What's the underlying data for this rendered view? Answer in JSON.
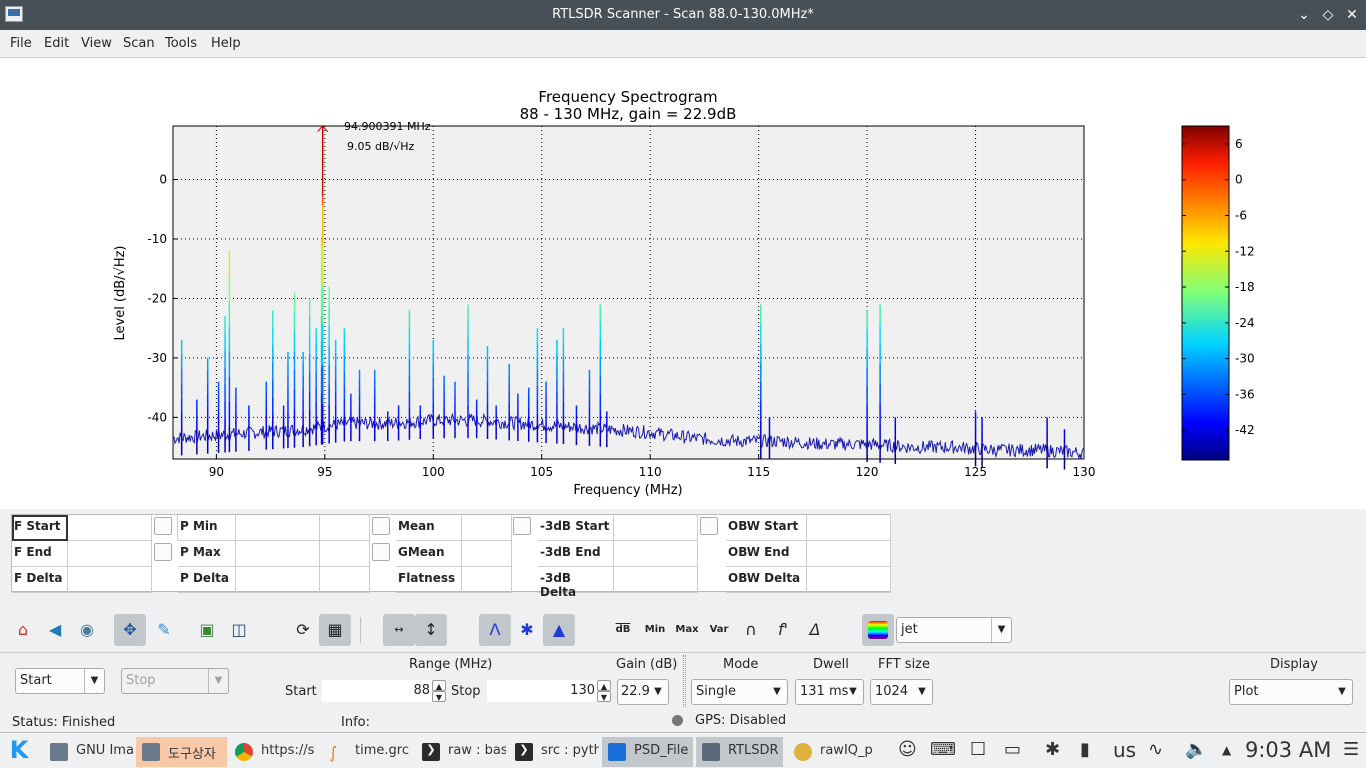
{
  "window": {
    "title": "RTLSDR Scanner - Scan 88.0-130.0MHz*"
  },
  "menu": [
    "File",
    "Edit",
    "View",
    "Scan",
    "Tools",
    "Help"
  ],
  "chart_data": {
    "type": "line",
    "title": "Frequency Spectrogram",
    "subtitle": "88 - 130 MHz, gain = 22.9dB",
    "xlabel": "Frequency (MHz)",
    "ylabel": "Level (dB/√Hz)",
    "xlim": [
      88,
      130
    ],
    "ylim": [
      -47,
      9
    ],
    "xticks": [
      90,
      95,
      100,
      105,
      110,
      115,
      120,
      125,
      130
    ],
    "yticks": [
      0,
      -10,
      -20,
      -30,
      -40
    ],
    "grid": true,
    "colormap": "jet",
    "colorbar": {
      "ticks": [
        6,
        0,
        -6,
        -12,
        -18,
        -24,
        -30,
        -36,
        -42
      ],
      "range": [
        -47,
        9
      ]
    },
    "noise_floor": [
      [
        88,
        -43.5
      ],
      [
        90,
        -43
      ],
      [
        92,
        -42.5
      ],
      [
        94,
        -42
      ],
      [
        96,
        -41
      ],
      [
        98,
        -41
      ],
      [
        100,
        -40.5
      ],
      [
        102,
        -40.5
      ],
      [
        104,
        -41
      ],
      [
        106,
        -41.5
      ],
      [
        108,
        -42
      ],
      [
        110,
        -42.5
      ],
      [
        112,
        -43.5
      ],
      [
        114,
        -44
      ],
      [
        116,
        -44
      ],
      [
        118,
        -44.5
      ],
      [
        120,
        -44.5
      ],
      [
        122,
        -45
      ],
      [
        124,
        -45
      ],
      [
        126,
        -45.5
      ],
      [
        128,
        -45.5
      ],
      [
        130,
        -46
      ]
    ],
    "peaks": [
      {
        "x": 88.4,
        "y": -27
      },
      {
        "x": 89.1,
        "y": -37
      },
      {
        "x": 89.6,
        "y": -30
      },
      {
        "x": 90.1,
        "y": -34
      },
      {
        "x": 90.4,
        "y": -23
      },
      {
        "x": 90.6,
        "y": -12
      },
      {
        "x": 90.9,
        "y": -35
      },
      {
        "x": 91.5,
        "y": -38
      },
      {
        "x": 92.3,
        "y": -34
      },
      {
        "x": 92.6,
        "y": -22
      },
      {
        "x": 93.1,
        "y": -38
      },
      {
        "x": 93.3,
        "y": -29
      },
      {
        "x": 93.6,
        "y": -19
      },
      {
        "x": 94.0,
        "y": -29
      },
      {
        "x": 94.3,
        "y": -20
      },
      {
        "x": 94.6,
        "y": -25
      },
      {
        "x": 94.85,
        "y": -10
      },
      {
        "x": 94.9,
        "y": 9.05
      },
      {
        "x": 95.2,
        "y": -18
      },
      {
        "x": 95.5,
        "y": -27
      },
      {
        "x": 95.9,
        "y": -25
      },
      {
        "x": 96.2,
        "y": -36
      },
      {
        "x": 96.6,
        "y": -32
      },
      {
        "x": 97.3,
        "y": -32
      },
      {
        "x": 97.9,
        "y": -39
      },
      {
        "x": 98.4,
        "y": -38
      },
      {
        "x": 98.9,
        "y": -22
      },
      {
        "x": 99.4,
        "y": -38
      },
      {
        "x": 100.0,
        "y": -27
      },
      {
        "x": 100.5,
        "y": -33
      },
      {
        "x": 101.0,
        "y": -34
      },
      {
        "x": 101.6,
        "y": -21
      },
      {
        "x": 102.0,
        "y": -37
      },
      {
        "x": 102.5,
        "y": -28
      },
      {
        "x": 102.9,
        "y": -38
      },
      {
        "x": 103.5,
        "y": -31
      },
      {
        "x": 103.9,
        "y": -36
      },
      {
        "x": 104.4,
        "y": -35
      },
      {
        "x": 104.8,
        "y": -25
      },
      {
        "x": 105.2,
        "y": -34
      },
      {
        "x": 105.7,
        "y": -27
      },
      {
        "x": 106.0,
        "y": -25
      },
      {
        "x": 106.6,
        "y": -38
      },
      {
        "x": 107.2,
        "y": -32
      },
      {
        "x": 107.7,
        "y": -21
      },
      {
        "x": 108.0,
        "y": -39
      },
      {
        "x": 115.1,
        "y": -21
      },
      {
        "x": 115.5,
        "y": -40
      },
      {
        "x": 120.0,
        "y": -22
      },
      {
        "x": 120.6,
        "y": -21
      },
      {
        "x": 121.3,
        "y": -40
      },
      {
        "x": 125.0,
        "y": -39
      },
      {
        "x": 125.3,
        "y": -40
      },
      {
        "x": 128.3,
        "y": -40
      },
      {
        "x": 129.1,
        "y": -42
      }
    ],
    "annotation": {
      "text": "94.900391 MHz",
      "text2": "9.05 dB/√Hz"
    }
  },
  "measurements": {
    "rows": [
      [
        "F Start",
        "P Min",
        "Mean",
        "-3dB Start",
        "OBW Start"
      ],
      [
        "F End",
        "P Max",
        "GMean",
        "-3dB End",
        "OBW End"
      ],
      [
        "F Delta",
        "P Delta",
        "Flatness",
        "-3dB Delta",
        "OBW Delta"
      ]
    ]
  },
  "toolbar": {
    "icons": [
      "home-icon",
      "back-icon",
      "forward-icon",
      "pan-icon",
      "configure-icon",
      "subplots-icon",
      "save-icon",
      "refresh-icon",
      "grid-icon",
      "fit-horizontal-icon",
      "fit-vertical-icon",
      "peak-icon",
      "peaks-icon",
      "fill-icon"
    ],
    "text_buttons": [
      "dB",
      "Min",
      "Max",
      "Var",
      "∩",
      "f'",
      "Δ"
    ],
    "colormap": "jet"
  },
  "controls": {
    "start_combo": "Start",
    "stop_combo": "Stop",
    "range_label": "Range (MHz)",
    "start_label": "Start",
    "start_value": "88",
    "stop_label": "Stop",
    "stop_value": "130",
    "gain_label": "Gain (dB)",
    "gain_value": "22.9",
    "mode_label": "Mode",
    "mode_value": "Single",
    "dwell_label": "Dwell",
    "dwell_value": "131 ms",
    "fft_label": "FFT size",
    "fft_value": "1024",
    "display_label": "Display",
    "display_value": "Plot"
  },
  "status": {
    "status": "Status: Finished",
    "info": "Info:",
    "gps": "GPS: Disabled"
  },
  "taskbar": {
    "tasks": [
      {
        "label": "GNU Ima",
        "color": "#6a7a8a"
      },
      {
        "label": "도구상자",
        "color": "#6a7a8a"
      },
      {
        "label": "https://s",
        "color": "#db4437"
      },
      {
        "label": "time.grc",
        "color": "#e67e22"
      },
      {
        "label": "raw : bas",
        "color": "#2b2b2b"
      },
      {
        "label": "src : pyth",
        "color": "#2b2b2b"
      },
      {
        "label": "PSD_File",
        "color": "#1d6fd8"
      },
      {
        "label": "RTLSDR",
        "color": "#5a6a7a"
      },
      {
        "label": "rawIQ_p",
        "color": "#e0b040"
      }
    ],
    "keyboard": "us",
    "clock": "9:03 AM"
  }
}
